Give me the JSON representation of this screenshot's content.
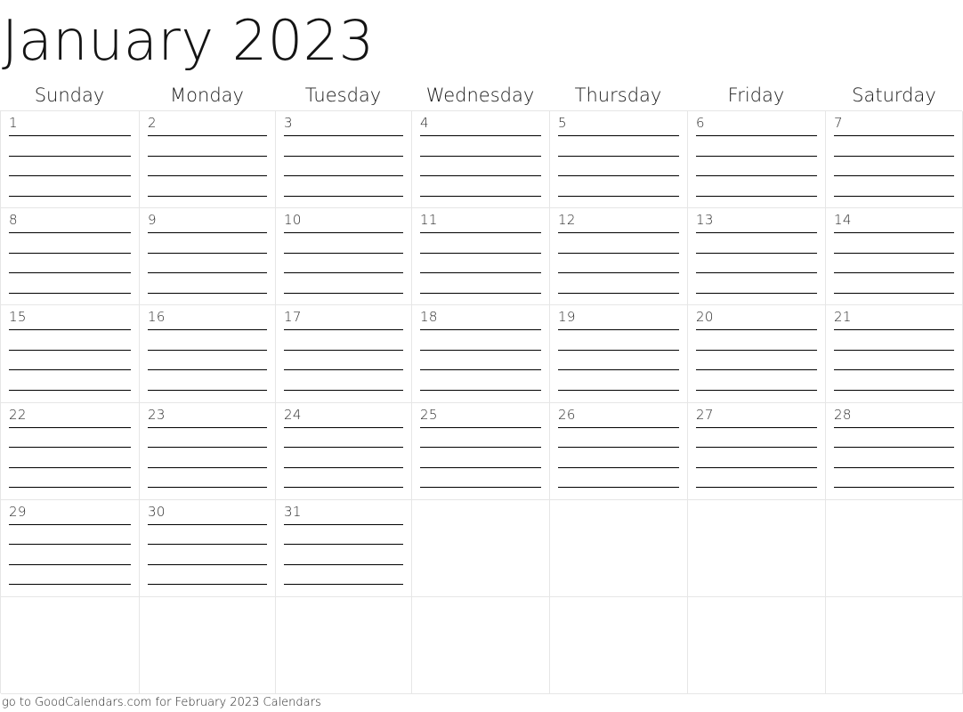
{
  "calendar": {
    "title": "January 2023",
    "month": "January",
    "year": "2023",
    "weekdays": [
      "Sunday",
      "Monday",
      "Tuesday",
      "Wednesday",
      "Thursday",
      "Friday",
      "Saturday"
    ],
    "lines_per_day": 4,
    "weeks": [
      [
        "1",
        "2",
        "3",
        "4",
        "5",
        "6",
        "7"
      ],
      [
        "8",
        "9",
        "10",
        "11",
        "12",
        "13",
        "14"
      ],
      [
        "15",
        "16",
        "17",
        "18",
        "19",
        "20",
        "21"
      ],
      [
        "22",
        "23",
        "24",
        "25",
        "26",
        "27",
        "28"
      ],
      [
        "29",
        "30",
        "31",
        "",
        "",
        "",
        ""
      ],
      [
        "",
        "",
        "",
        "",
        "",
        "",
        ""
      ]
    ]
  },
  "footer": {
    "text": "go to GoodCalendars.com for February 2023 Calendars"
  },
  "colors": {
    "background": "#ffffff",
    "grid_line": "#e6e6e6",
    "rule_line": "#000000",
    "title_text": "#141414",
    "day_number_text": "#2b2b2b"
  }
}
